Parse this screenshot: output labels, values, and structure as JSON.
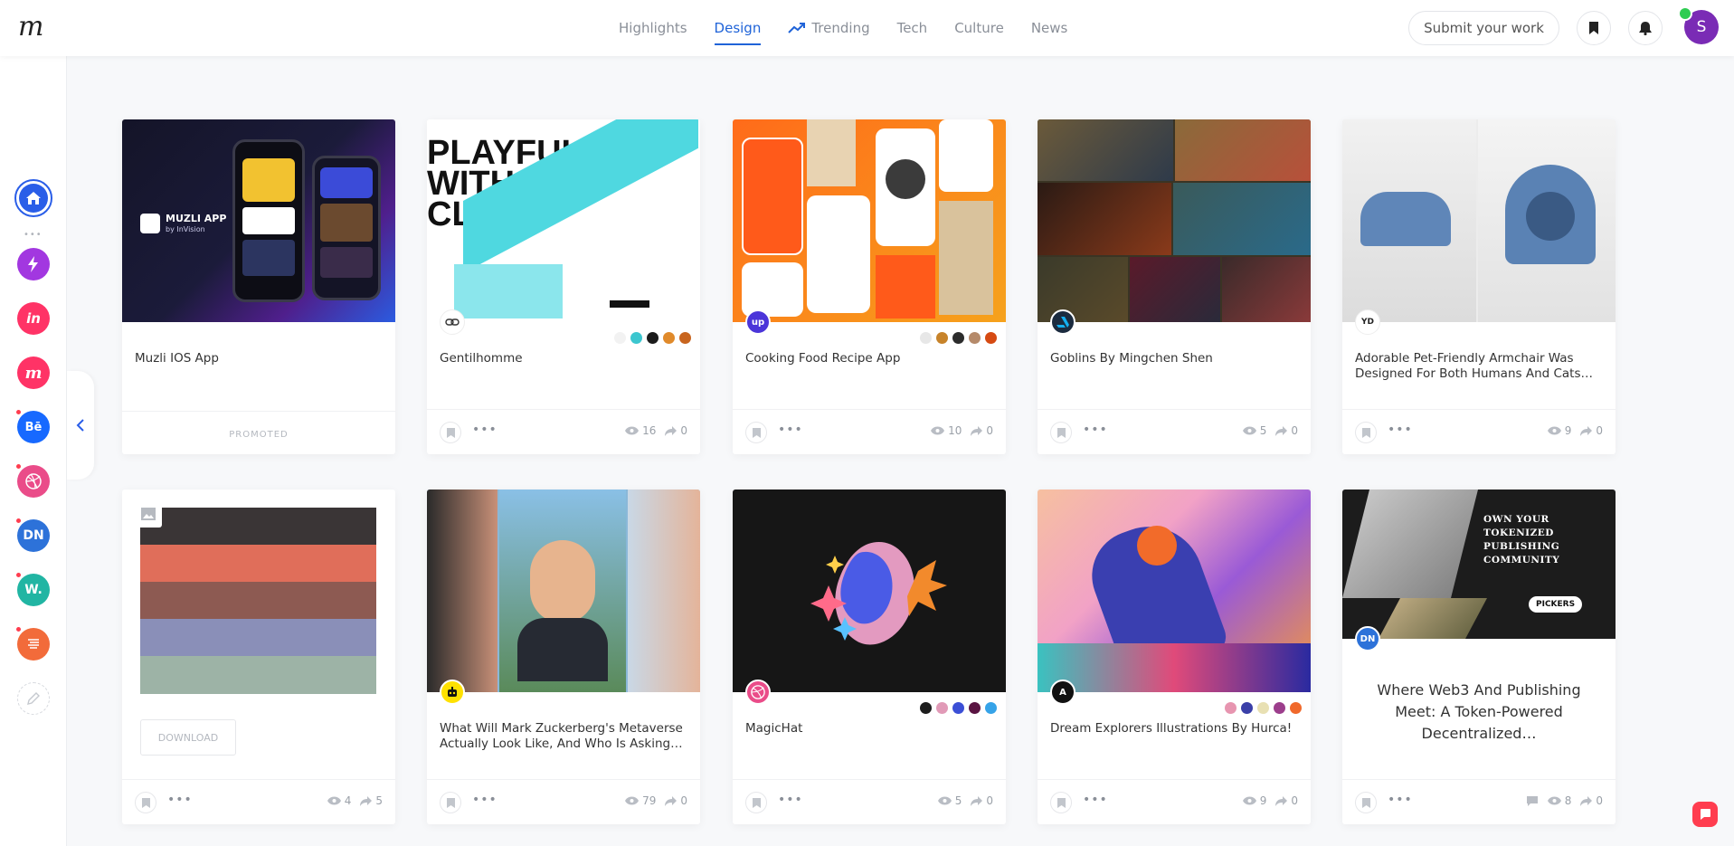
{
  "brand": {
    "logo": "m"
  },
  "nav": {
    "tabs": [
      {
        "label": "Highlights"
      },
      {
        "label": "Design"
      },
      {
        "label": "Trending"
      },
      {
        "label": "Tech"
      },
      {
        "label": "Culture"
      },
      {
        "label": "News"
      }
    ],
    "active_tab": "Design",
    "submit_label": "Submit your work",
    "avatar_letter": "S"
  },
  "sidebar": {
    "items": [
      {
        "name": "home",
        "label": ""
      },
      {
        "name": "bolt",
        "label": ""
      },
      {
        "name": "invision",
        "label": "in"
      },
      {
        "name": "muzli",
        "label": "m"
      },
      {
        "name": "behance",
        "label": "Bē"
      },
      {
        "name": "dribbble",
        "label": ""
      },
      {
        "name": "designer-news",
        "label": "DN"
      },
      {
        "name": "webdesigner",
        "label": "W."
      },
      {
        "name": "producthunt",
        "label": ""
      },
      {
        "name": "edit",
        "label": ""
      }
    ]
  },
  "cards": [
    {
      "title": "Muzli IOS App",
      "promoted": "PROMOTED",
      "thumb_text": "MUZLI APP",
      "thumb_sub": "by InVision"
    },
    {
      "title": "Gentilhomme",
      "views": "16",
      "shares": "0",
      "thumb_text": "PLAYFUL WITH CLASS",
      "colors": [
        "#f2f2f2",
        "#3cc6cf",
        "#1b1b1b",
        "#e08a2b",
        "#c8651f"
      ]
    },
    {
      "title": "Cooking Food Recipe App",
      "views": "10",
      "shares": "0",
      "source": "up",
      "colors": [
        "#e7e7e7",
        "#c7832a",
        "#2c2c2c",
        "#b58a6a",
        "#d64a12"
      ]
    },
    {
      "title": "Goblins By Mingchen Shen",
      "views": "5",
      "shares": "0"
    },
    {
      "title": "Adorable Pet-Friendly Armchair Was Designed For Both Humans And Cats…",
      "views": "9",
      "shares": "0",
      "source": "YD"
    },
    {
      "title": "",
      "download": "DOWNLOAD",
      "views": "4",
      "shares": "5"
    },
    {
      "title": "What Will Mark Zuckerberg's Metaverse Actually Look Like, And Who Is Asking…",
      "views": "79",
      "shares": "0"
    },
    {
      "title": "MagicHat",
      "views": "5",
      "shares": "0",
      "colors": [
        "#1d1d1d",
        "#e19ab7",
        "#3b4fd6",
        "#5a1442",
        "#36a3e8"
      ]
    },
    {
      "title": "Dream Explorers Illustrations By Hurca!",
      "views": "9",
      "shares": "0",
      "source": "A",
      "colors": [
        "#e795b0",
        "#3a3fa8",
        "#e8e0b3",
        "#9c3e8c",
        "#f0692b"
      ]
    },
    {
      "title": "Where Web3 And Publishing Meet: A Token-Powered Decentralized…",
      "views": "8",
      "shares": "0",
      "source": "DN",
      "thumb_text": "OWN YOUR TOKENIZED PUBLISHING COMMUNITY",
      "thumb_badge": "PICKERS"
    }
  ]
}
